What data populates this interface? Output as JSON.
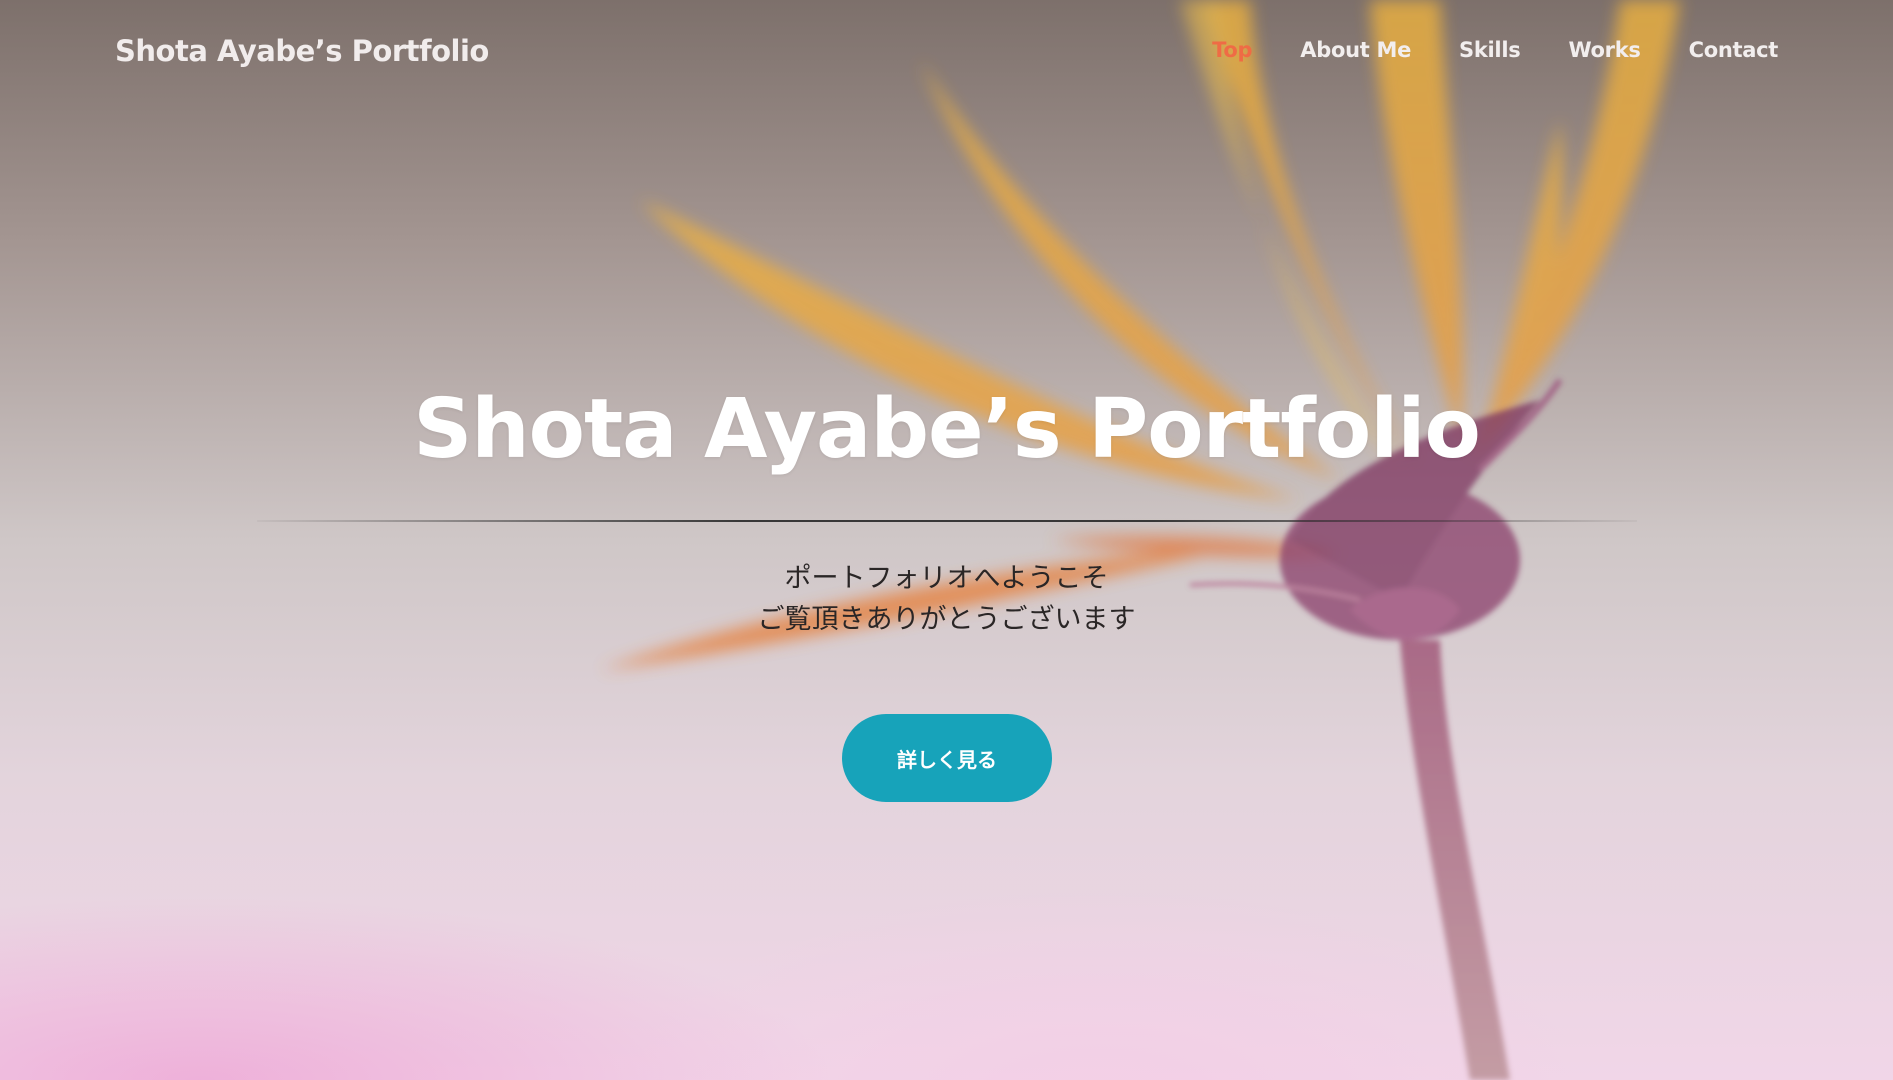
{
  "header": {
    "logo": "Shota Ayabe’s Portfolio",
    "nav": [
      {
        "label": "Top",
        "active": true
      },
      {
        "label": "About Me",
        "active": false
      },
      {
        "label": "Skills",
        "active": false
      },
      {
        "label": "Works",
        "active": false
      },
      {
        "label": "Contact",
        "active": false
      }
    ]
  },
  "hero": {
    "title": "Shota Ayabe’s Portfolio",
    "subtitle_lines": [
      "ポートフォリオへようこそ",
      "ご覧頂きありがとうございます"
    ],
    "cta_label": "詳しく見る",
    "background_image": "flower-photo"
  },
  "colors": {
    "nav_active": "#ef6b45",
    "nav_text": "#f2eeee",
    "button": "#17a3ba",
    "title": "#ffffff",
    "subtitle": "#2a2626"
  }
}
